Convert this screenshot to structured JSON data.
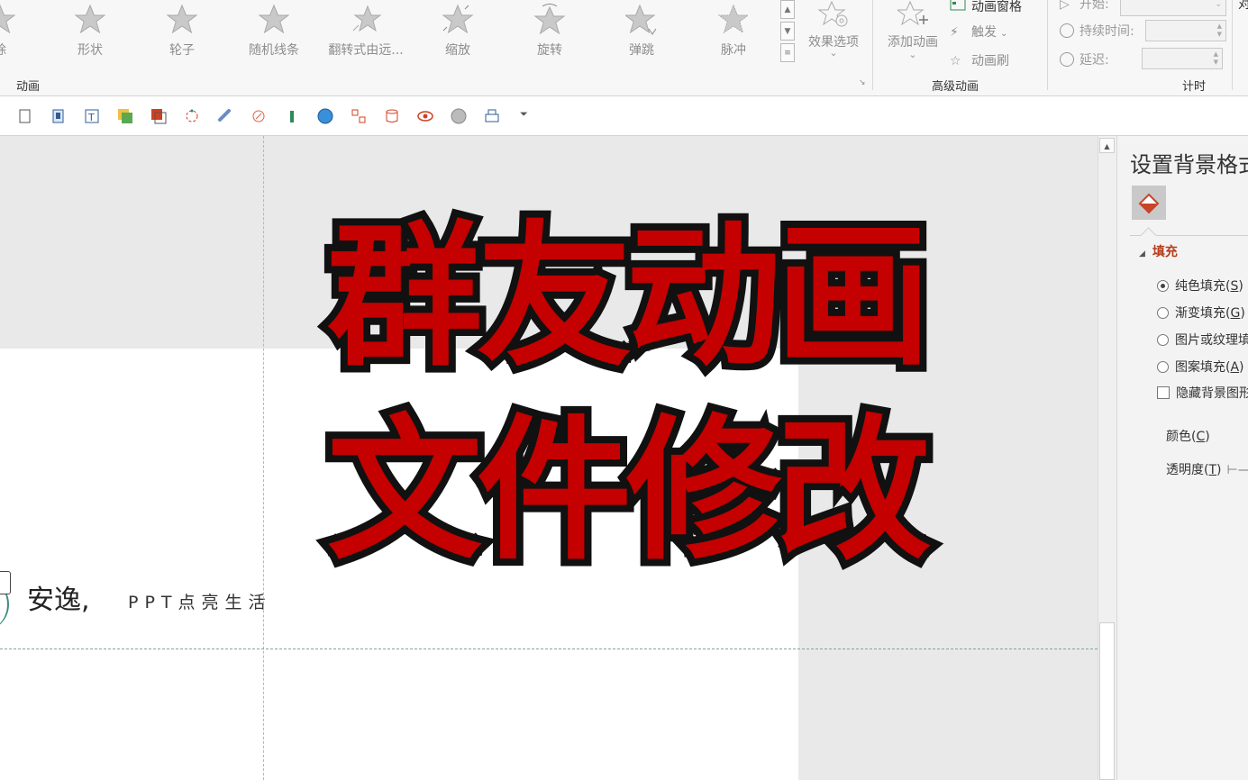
{
  "ribbon": {
    "animations": [
      {
        "label": "除",
        "icon": "star-wipe-icon"
      },
      {
        "label": "形状",
        "icon": "star-shape-icon"
      },
      {
        "label": "轮子",
        "icon": "star-wheel-icon"
      },
      {
        "label": "随机线条",
        "icon": "star-random-bars-icon"
      },
      {
        "label": "翻转式由远...",
        "icon": "star-grow-turn-icon"
      },
      {
        "label": "缩放",
        "icon": "star-zoom-icon"
      },
      {
        "label": "旋转",
        "icon": "star-swivel-icon"
      },
      {
        "label": "弹跳",
        "icon": "star-bounce-icon"
      },
      {
        "label": "脉冲",
        "icon": "star-pulse-icon"
      }
    ],
    "effect_options": "效果选项",
    "add_animation": "添加动画",
    "animation_pane": "动画窗格",
    "trigger": "触发",
    "animation_painter": "动画刷",
    "group_animation": "动画",
    "group_advanced": "高级动画",
    "group_timing": "计时",
    "start_label": "开始:",
    "duration_label": "持续时间:",
    "delay_label": "延迟:",
    "cut_label": "对"
  },
  "overlay": {
    "line1": "群友动画",
    "line2": "文件修改"
  },
  "slide": {
    "footer_name": "安逸,",
    "footer_sub": "PPT点亮生活"
  },
  "pane": {
    "title": "设置背景格式",
    "section_fill": "填充",
    "options": [
      {
        "text": "纯色填充(",
        "key": "S",
        "selected": true
      },
      {
        "text": "渐变填充(",
        "key": "G",
        "selected": false
      },
      {
        "text": "图片或纹理填充",
        "key": "",
        "selected": false
      },
      {
        "text": "图案填充(",
        "key": "A",
        "selected": false
      }
    ],
    "hide_bg": "隐藏背景图形",
    "color_label": "颜色(",
    "color_key": "C",
    "transparency_label": "透明度(",
    "transparency_key": "T"
  },
  "colors": {
    "overlay_red": "#c40000",
    "section_orange": "#b53c1a",
    "fill_icon": "#c8442a"
  }
}
